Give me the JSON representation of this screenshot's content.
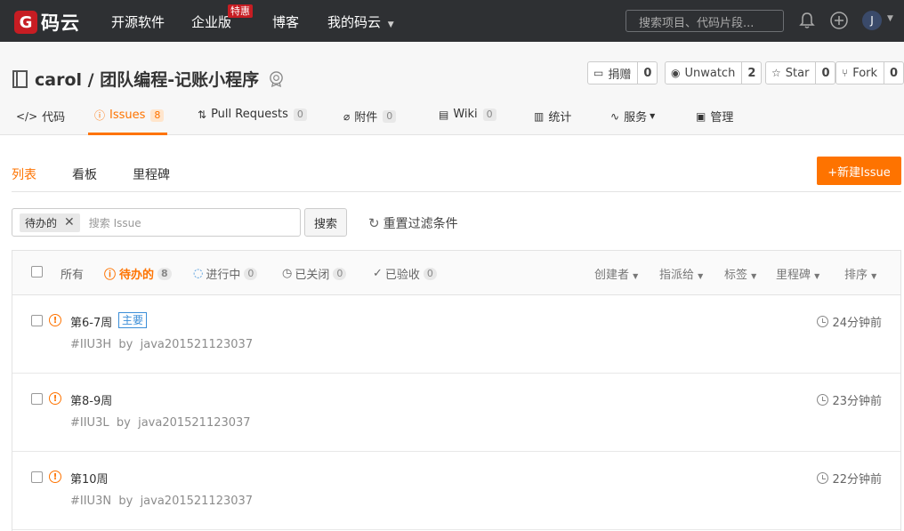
{
  "topnav": {
    "logo_letter": "G",
    "logo_text": "码云",
    "items": [
      "开源软件",
      "企业版",
      "博客",
      "我的码云"
    ],
    "badge": "特惠",
    "search_placeholder": "搜索项目、代码片段...",
    "avatar_letter": "J"
  },
  "repo": {
    "title": "carol / 团队编程-记账小程序",
    "actions": [
      {
        "label": "捐赠",
        "count": "0"
      },
      {
        "label": "Unwatch",
        "count": "2"
      },
      {
        "label": "Star",
        "count": "0"
      },
      {
        "label": "Fork",
        "count": "0"
      }
    ]
  },
  "tabs": [
    {
      "label": "代码"
    },
    {
      "label": "Issues",
      "count": "8"
    },
    {
      "label": "Pull Requests",
      "count": "0"
    },
    {
      "label": "附件",
      "count": "0"
    },
    {
      "label": "Wiki",
      "count": "0"
    },
    {
      "label": "统计"
    },
    {
      "label": "服务"
    },
    {
      "label": "管理"
    }
  ],
  "subnav": [
    "列表",
    "看板",
    "里程碑"
  ],
  "new_issue": "+新建Issue",
  "filter": {
    "chip": "待办的",
    "placeholder": "搜索 Issue",
    "search_btn": "搜索",
    "reset": "重置过滤条件"
  },
  "states": [
    {
      "label": "所有"
    },
    {
      "label": "待办的",
      "count": "8"
    },
    {
      "label": "进行中",
      "count": "0"
    },
    {
      "label": "已关闭",
      "count": "0"
    },
    {
      "label": "已验收",
      "count": "0"
    }
  ],
  "dropdowns": [
    "创建者",
    "指派给",
    "标签",
    "里程碑",
    "排序"
  ],
  "issues": [
    {
      "title": "第6-7周",
      "tag": "主要",
      "id": "#IIU3H",
      "by": "by",
      "author": "java201521123037",
      "time": "24分钟前"
    },
    {
      "title": "第8-9周",
      "id": "#IIU3L",
      "by": "by",
      "author": "java201521123037",
      "time": "23分钟前"
    },
    {
      "title": "第10周",
      "id": "#IIU3N",
      "by": "by",
      "author": "java201521123037",
      "time": "22分钟前"
    }
  ]
}
